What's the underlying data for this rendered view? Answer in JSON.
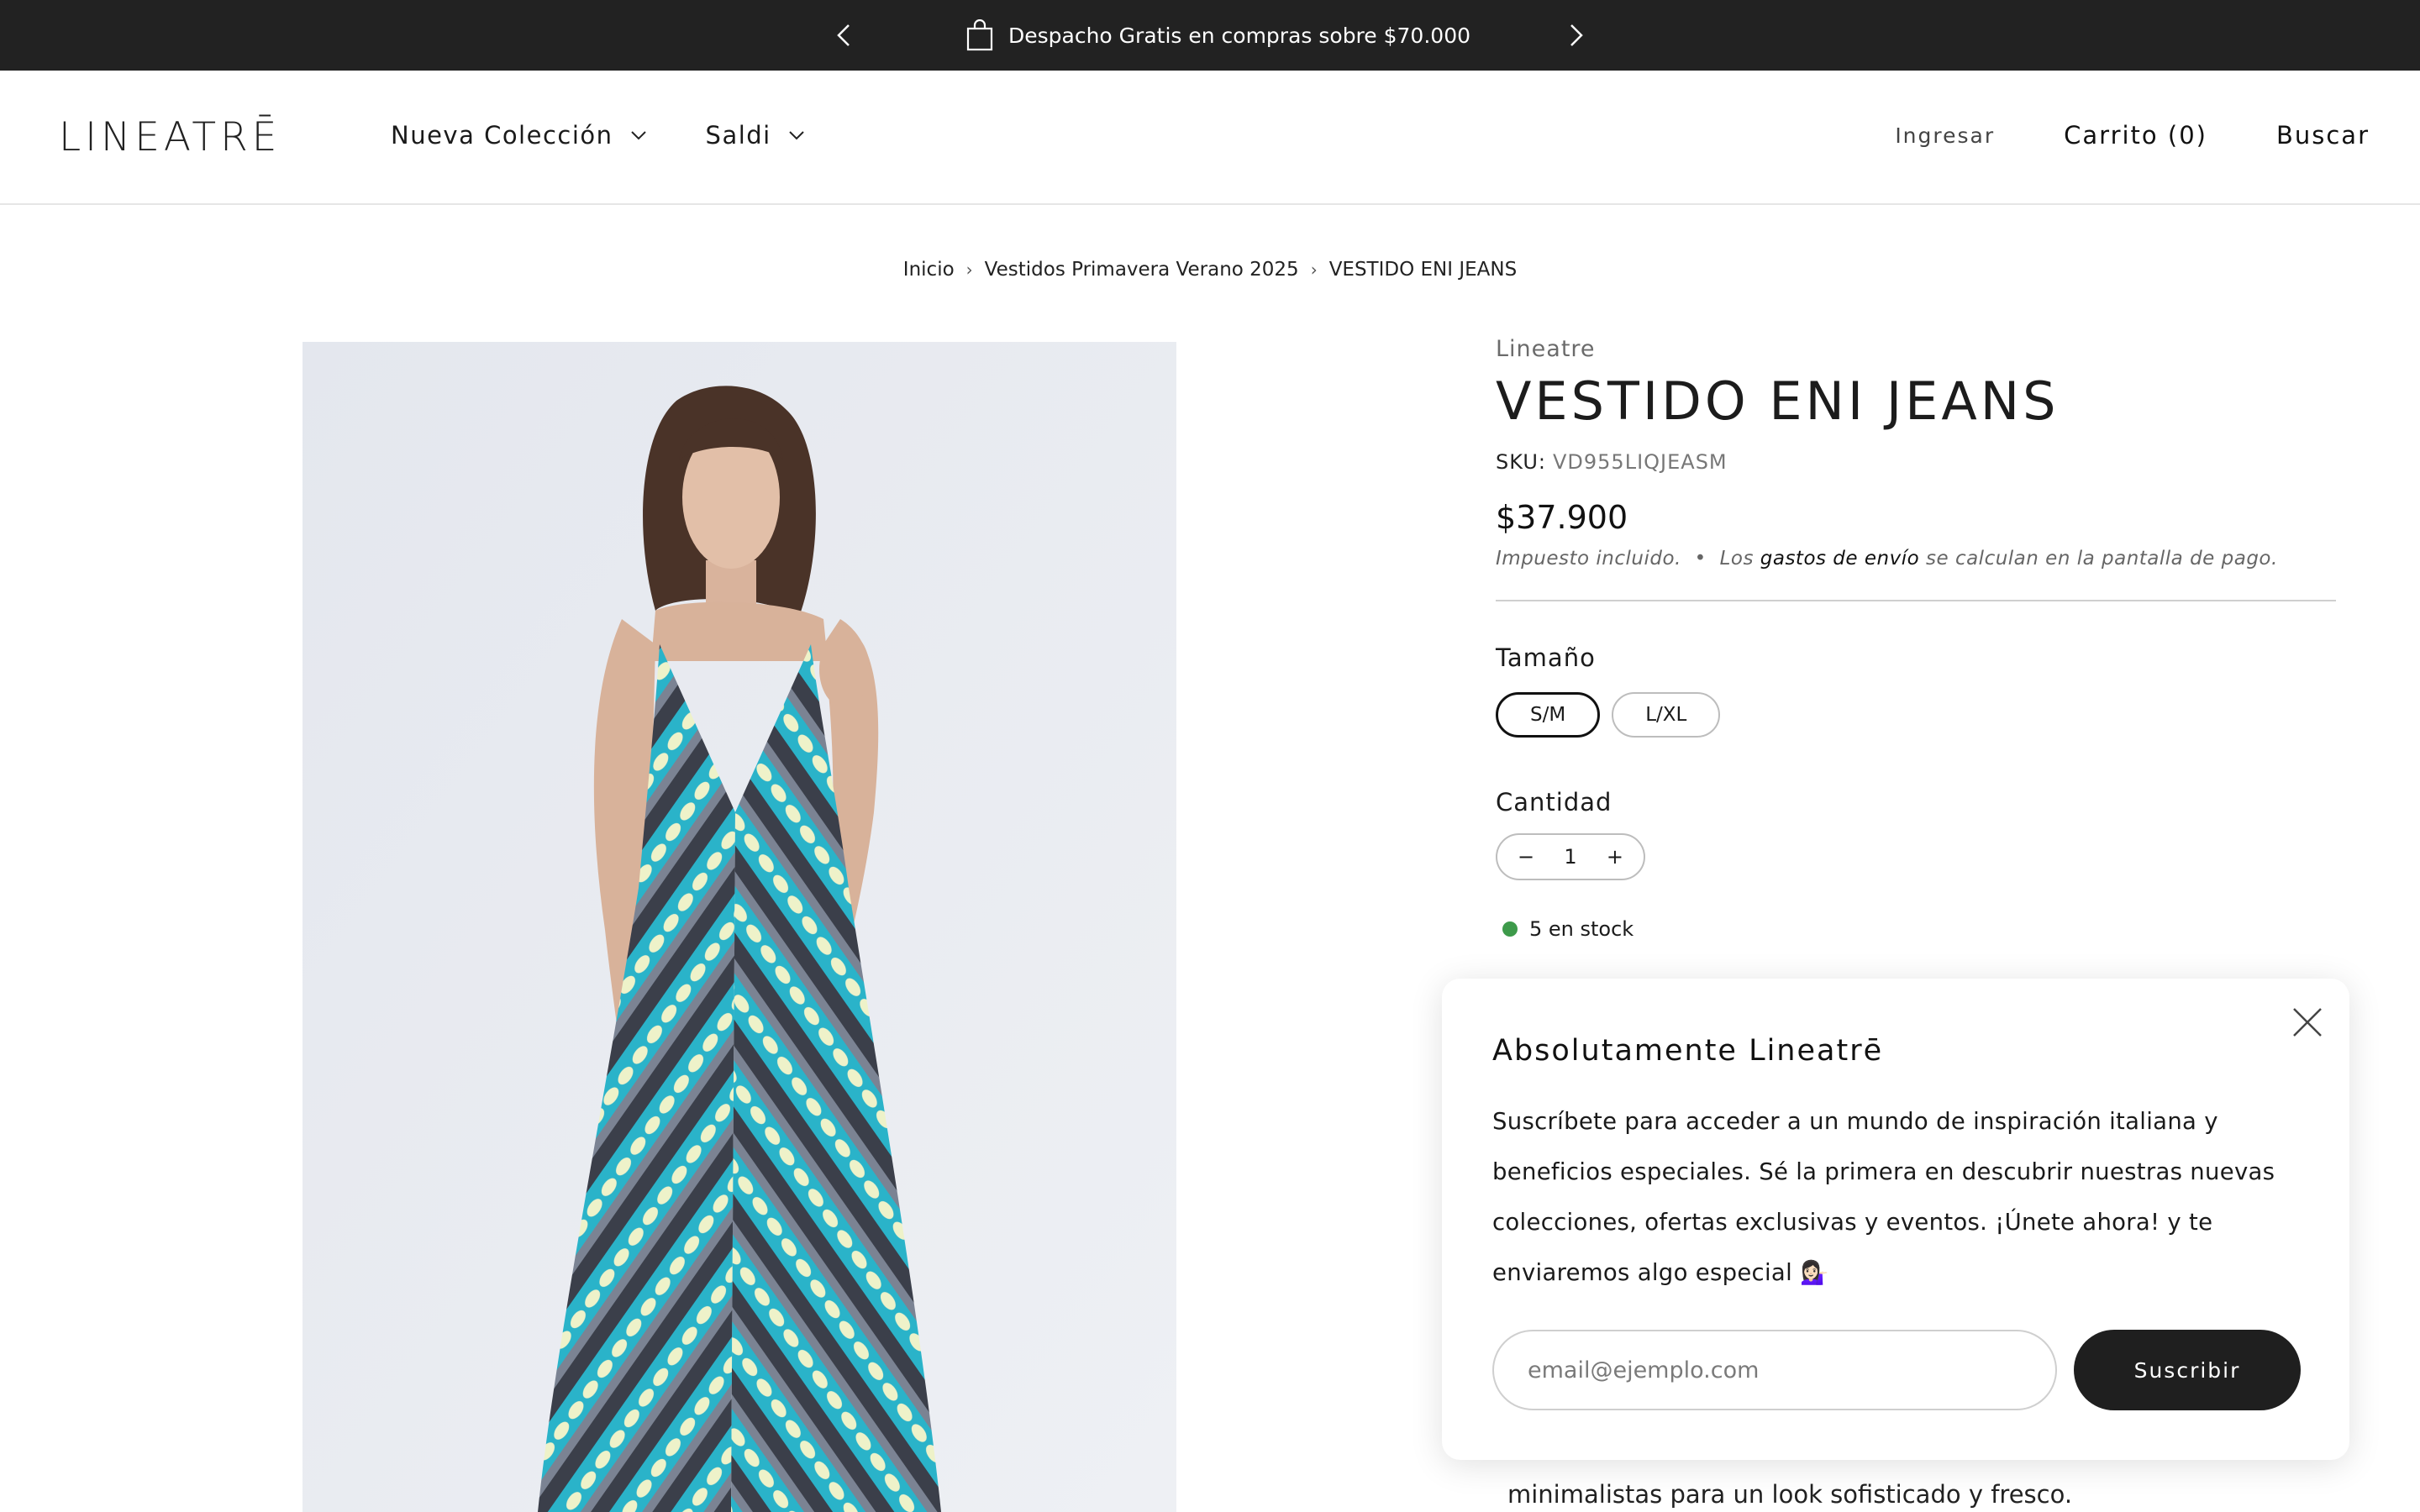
{
  "announcement": {
    "text": "Despacho Gratis en compras sobre $70.000",
    "icon": "shopping-bag-icon",
    "prev_icon": "chevron-left-icon",
    "next_icon": "chevron-right-icon"
  },
  "header": {
    "logo": "LINEATRĒ",
    "nav": [
      {
        "label": "Nueva Colección"
      },
      {
        "label": "Saldi"
      }
    ],
    "login": "Ingresar",
    "cart": "Carrito (0)",
    "search": "Buscar"
  },
  "breadcrumb": [
    "Inicio",
    "Vestidos Primavera Verano 2025",
    "VESTIDO ENI JEANS"
  ],
  "product": {
    "vendor": "Lineatre",
    "title": "VESTIDO ENI JEANS",
    "sku_label": "SKU:",
    "sku": "VD955LIQJEASM",
    "price": "$37.900",
    "tax_text": "Impuesto incluido.",
    "bullet": "•",
    "shipping_prefix": "Los",
    "shipping_link": "gastos de envío",
    "shipping_suffix": "se calculan en la pantalla de pago.",
    "size_label": "Tamaño",
    "sizes": [
      "S/M",
      "L/XL"
    ],
    "selected_size": "S/M",
    "quantity_label": "Cantidad",
    "quantity": "1",
    "minus": "−",
    "plus": "+",
    "stock": "5 en stock",
    "stock_color": "#3d9a4a",
    "description_tail": "minimalistas para un look sofisticado y fresco."
  },
  "popup": {
    "title": "Absolutamente Lineatrē",
    "body": "Suscríbete para acceder a un mundo de inspiración italiana y beneficios especiales. Sé la primera en descubrir nuestras nuevas colecciones, ofertas exclusivas y eventos. ¡Únete ahora! y te enviaremos algo especial 💁🏻‍♀️",
    "email_placeholder": "email@ejemplo.com",
    "button": "Suscribir"
  },
  "colors": {
    "announcement_bg": "#222222",
    "button_bg": "#1f1f1f",
    "accent_teal": "#2ab3c9"
  }
}
